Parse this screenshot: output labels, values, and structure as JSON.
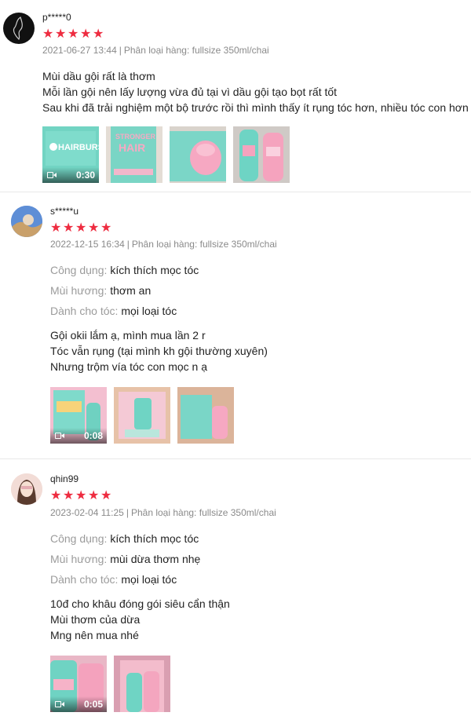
{
  "reviews": [
    {
      "username": "p*****0",
      "rating": 5,
      "date": "2021-06-27 13:44",
      "variation_label": "Phân loại hàng:",
      "variation_value": "fullsize 350ml/chai",
      "attributes": [],
      "lines": [
        "Mùi dầu gội rất là thơm",
        "Mỗi lần gội nên lấy lượng vừa đủ tại vì dầu gội tạo bọt rất tốt",
        "Sau khi đã trải nghiệm một bộ trước rồi thì mình thấy ít rụng tóc hơn, nhiều tóc con hơn"
      ],
      "media": [
        {
          "type": "video",
          "duration": "0:30",
          "caption": "HAIRBURS"
        },
        {
          "type": "image",
          "caption": "STRONGER HAIR"
        },
        {
          "type": "image",
          "caption": ""
        },
        {
          "type": "image",
          "caption": ""
        }
      ]
    },
    {
      "username": "s*****u",
      "rating": 5,
      "date": "2022-12-15 16:34",
      "variation_label": "Phân loại hàng:",
      "variation_value": "fullsize 350ml/chai",
      "attributes": [
        {
          "key": "Công dụng:",
          "value": "kích thích mọc tóc"
        },
        {
          "key": "Mùi hương:",
          "value": "thơm an"
        },
        {
          "key": "Dành cho tóc:",
          "value": "mọi loại tóc"
        }
      ],
      "lines": [
        "Gội okii lắm ạ, mình mua lần 2 r",
        "Tóc vẫn rụng (tại mình kh gội thường xuyên)",
        "Nhưng trộm vía tóc con mọc n ạ"
      ],
      "media": [
        {
          "type": "video",
          "duration": "0:08",
          "caption": ""
        },
        {
          "type": "image",
          "caption": ""
        },
        {
          "type": "image",
          "caption": ""
        }
      ]
    },
    {
      "username": "qhin99",
      "rating": 5,
      "date": "2023-02-04 11:25",
      "variation_label": "Phân loại hàng:",
      "variation_value": "fullsize 350ml/chai",
      "attributes": [
        {
          "key": "Công dụng:",
          "value": "kích thích mọc tóc"
        },
        {
          "key": "Mùi hương:",
          "value": "mùi dừa thơm nhẹ"
        },
        {
          "key": "Dành cho tóc:",
          "value": "mọi loại tóc"
        }
      ],
      "lines": [
        "10đ cho khâu đóng gói siêu cẩn thận",
        "Mùi thơm của dừa",
        "Mng nên mua nhé"
      ],
      "media": [
        {
          "type": "video",
          "duration": "0:05",
          "caption": ""
        },
        {
          "type": "image",
          "caption": ""
        }
      ]
    }
  ],
  "icons": {
    "star": "star-icon",
    "video": "video-camera-icon"
  },
  "colors": {
    "star": "#ee2c40",
    "muted": "#8a8a8a",
    "text": "#222222",
    "mint": "#6fd6c6",
    "pink": "#f6a8c2"
  }
}
